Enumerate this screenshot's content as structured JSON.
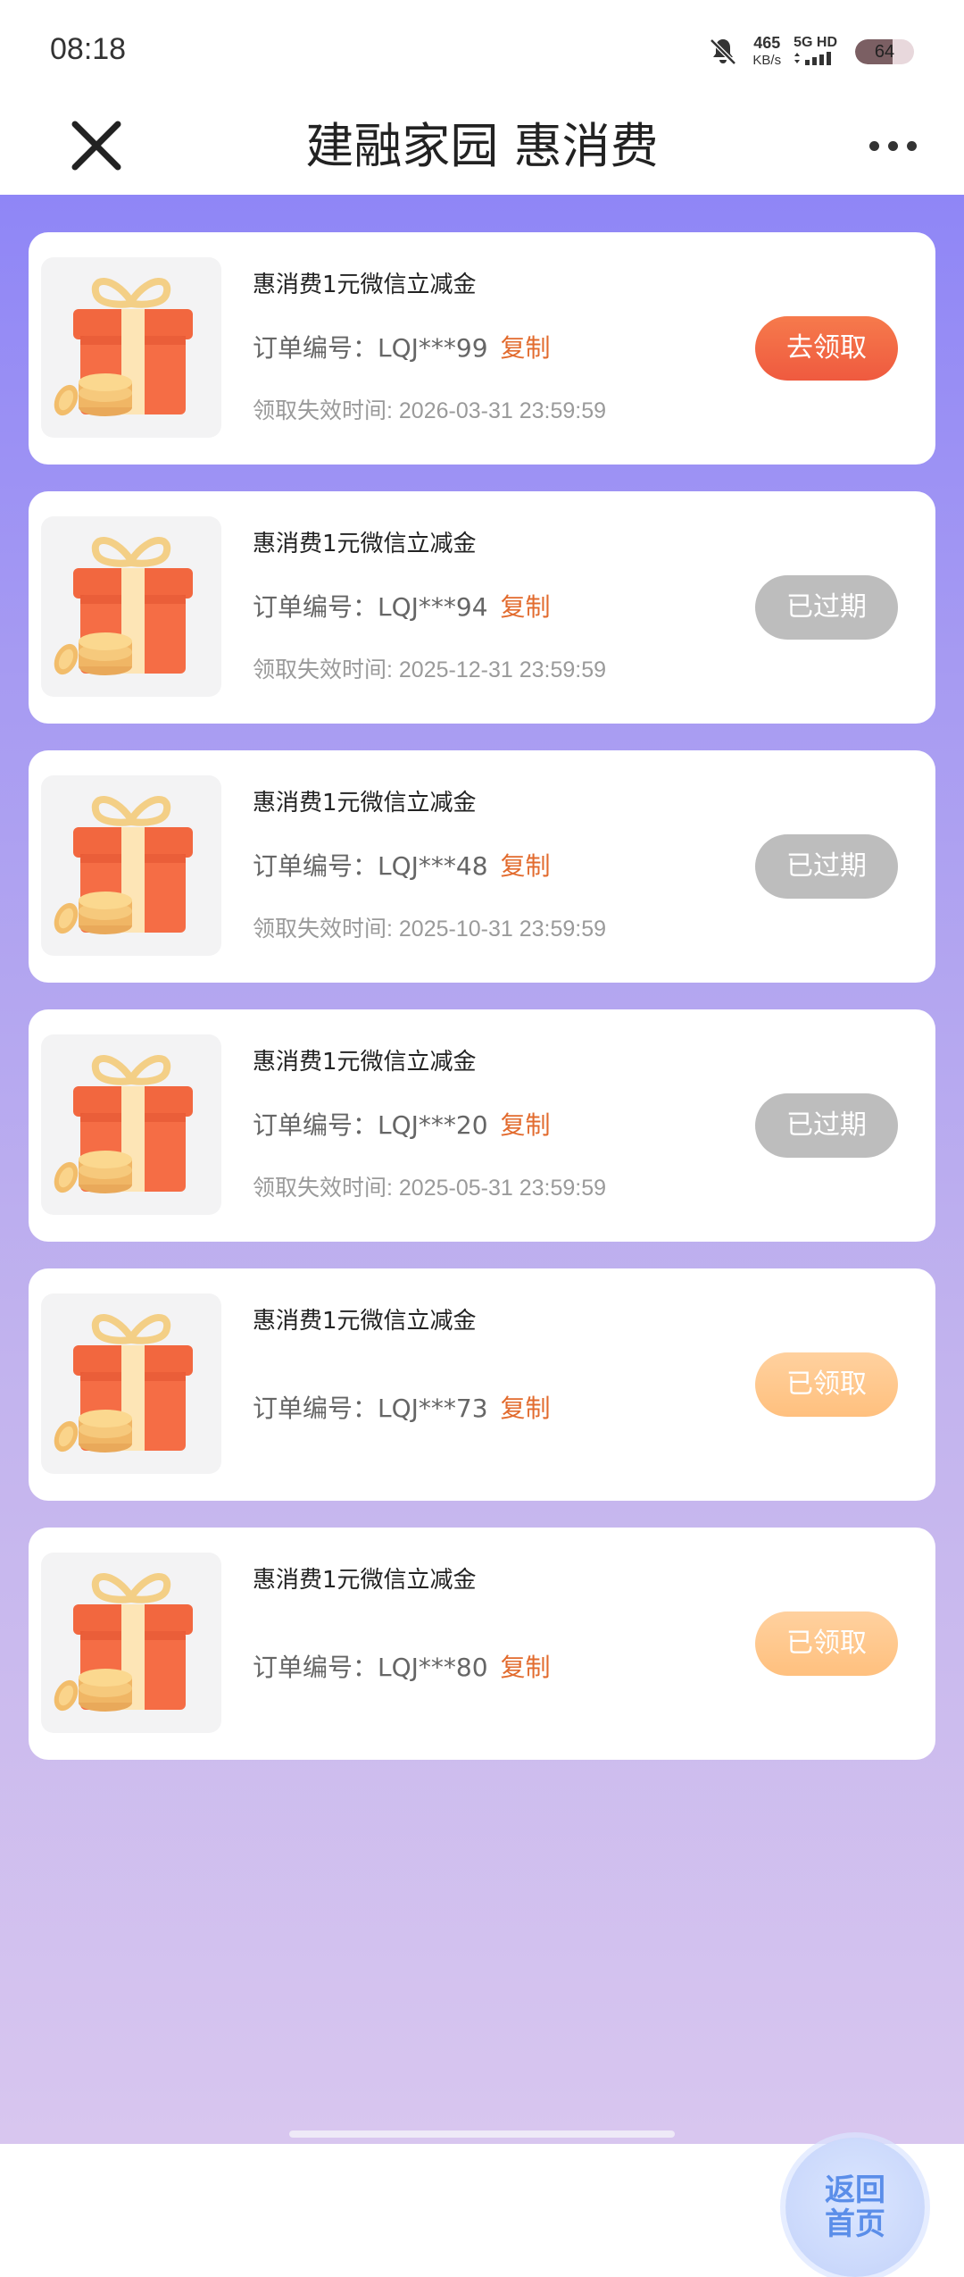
{
  "status_bar": {
    "time": "08:18",
    "net_speed_value": "465",
    "net_speed_unit": "KB/s",
    "network": "5G HD",
    "battery_level": "64"
  },
  "header": {
    "title": "建融家园 惠消费"
  },
  "colors": {
    "accent": "#e26b2e",
    "claim_button": "#f2603f",
    "expired_button": "#bdbdbd",
    "claimed_button": "#ffc88c",
    "home_button_text": "#5b8ee9"
  },
  "vouchers": [
    {
      "title": "惠消费1元微信立减金",
      "order_label": "订单编号：",
      "order_no": "LQJ***99",
      "copy_label": "复制",
      "expiry": "领取失效时间: 2026-03-31 23:59:59",
      "status": "去领取",
      "state": "claim"
    },
    {
      "title": "惠消费1元微信立减金",
      "order_label": "订单编号：",
      "order_no": "LQJ***94",
      "copy_label": "复制",
      "expiry": "领取失效时间: 2025-12-31 23:59:59",
      "status": "已过期",
      "state": "expired"
    },
    {
      "title": "惠消费1元微信立减金",
      "order_label": "订单编号：",
      "order_no": "LQJ***48",
      "copy_label": "复制",
      "expiry": "领取失效时间: 2025-10-31 23:59:59",
      "status": "已过期",
      "state": "expired"
    },
    {
      "title": "惠消费1元微信立减金",
      "order_label": "订单编号：",
      "order_no": "LQJ***20",
      "copy_label": "复制",
      "expiry": "领取失效时间: 2025-05-31 23:59:59",
      "status": "已过期",
      "state": "expired"
    },
    {
      "title": "惠消费1元微信立减金",
      "order_label": "订单编号：",
      "order_no": "LQJ***73",
      "copy_label": "复制",
      "status": "已领取",
      "state": "claimed"
    },
    {
      "title": "惠消费1元微信立减金",
      "order_label": "订单编号：",
      "order_no": "LQJ***80",
      "copy_label": "复制",
      "status": "已领取",
      "state": "claimed"
    }
  ],
  "home_button": {
    "line1": "返回",
    "line2": "首页"
  }
}
